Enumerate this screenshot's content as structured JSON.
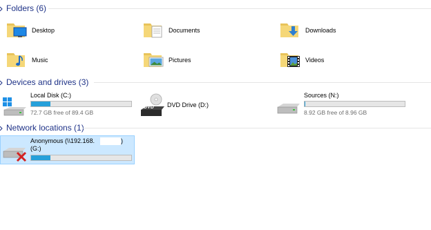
{
  "groups": {
    "folders": {
      "title": "Folders (6)"
    },
    "devices": {
      "title": "Devices and drives (3)"
    },
    "network": {
      "title": "Network locations (1)"
    }
  },
  "folders": [
    {
      "label": "Desktop",
      "icon": "desktop-folder-icon"
    },
    {
      "label": "Documents",
      "icon": "documents-folder-icon"
    },
    {
      "label": "Downloads",
      "icon": "downloads-folder-icon"
    },
    {
      "label": "Music",
      "icon": "music-folder-icon"
    },
    {
      "label": "Pictures",
      "icon": "pictures-folder-icon"
    },
    {
      "label": "Videos",
      "icon": "videos-folder-icon"
    }
  ],
  "drives": [
    {
      "name": "Local Disk (C:)",
      "free": "72.7 GB free of 89.4 GB",
      "used_fraction": 0.19,
      "icon": "windows-drive-icon"
    },
    {
      "name": "DVD Drive (D:)",
      "icon": "dvd-drive-icon"
    },
    {
      "name": "Sources (N:)",
      "free": "8.92 GB free of 8.96 GB",
      "used_fraction": 0.005,
      "icon": "hard-drive-icon"
    }
  ],
  "network": [
    {
      "name_line1": "Anonymous (\\\\192.168.",
      "name_line2": "(G:)",
      "used_fraction": 0.19,
      "icon": "disconnected-network-drive-icon"
    }
  ],
  "colors": {
    "header": "#1e3287",
    "bar_fill": "#26a0da",
    "selection": "#cce8ff"
  }
}
